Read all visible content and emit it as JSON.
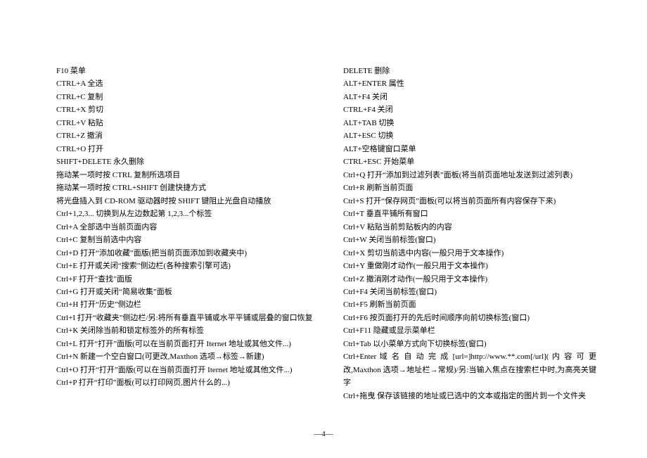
{
  "left": [
    "F10 菜单",
    "CTRL+A 全选",
    "CTRL+C 复制",
    "CTRL+X 剪切",
    "CTRL+V 粘贴",
    "CTRL+Z 撤消",
    "CTRL+O 打开",
    "SHIFT+DELETE 永久删除",
    "拖动某一项时按 CTRL 复制所选项目",
    "拖动某一项时按 CTRL+SHIFT 创建快捷方式",
    "将光盘插入到 CD-ROM 驱动器时按 SHIFT 键阻止光盘自动播放",
    "Ctrl+1,2,3...   切换到从左边数起第 1,2,3...个标签",
    "Ctrl+A   全部选中当前页面内容",
    "Ctrl+C   复制当前选中内容",
    "Ctrl+D   打开“添加收藏”面版(把当前页面添加到收藏夹中)",
    "Ctrl+E   打开或关闭“搜索”侧边栏(各种搜索引擎可选)",
    "Ctrl+F   打开“查找”面版",
    "Ctrl+G   打开或关闭“简易收集”面板",
    "Ctrl+H   打开“历史”侧边栏",
    "Ctrl+I   打开“收藏夹”侧边栏/另:将所有垂直平铺或水平平铺或层叠的窗口恢复",
    "Ctrl+K   关闭除当前和锁定标签外的所有标签",
    "Ctrl+L   打开“打开”面版(可以在当前页面打开 Iternet 地址或其他文件...)",
    "Ctrl+N   新建一个空白窗口(可更改,Maxthon 选项→标签→新建)",
    "Ctrl+O   打开“打开”面版(可以在当前页面打开 Iternet 地址或其他文件...)",
    "Ctrl+P   打开“打印”面板(可以打印网页,图片什么的...)"
  ],
  "right": [
    "DELETE 删除",
    "ALT+ENTER 属性",
    "ALT+F4 关闭",
    "CTRL+F4 关闭",
    "ALT+TAB 切换",
    "ALT+ESC 切换",
    "ALT+空格键窗口菜单",
    "CTRL+ESC 开始菜单",
    "Ctrl+Q   打开“添加到过滤列表”面板(将当前页面地址发送到过滤列表)",
    "Ctrl+R   刷新当前页面",
    "Ctrl+S   打开“保存网页”面板(可以将当前页面所有内容保存下来)",
    "Ctrl+T   垂直平铺所有窗口",
    "Ctrl+V   粘贴当前剪贴板内的内容",
    "Ctrl+W   关闭当前标签(窗口)",
    "Ctrl+X   剪切当前选中内容(一般只用于文本操作)",
    "Ctrl+Y   重做刚才动作(一般只用于文本操作)",
    "Ctrl+Z   撤消刚才动作(一般只用于文本操作)",
    "Ctrl+F4   关闭当前标签(窗口)",
    "Ctrl+F5   刷新当前页面",
    "Ctrl+F6   按页面打开的先后时间顺序向前切换标签(窗口)",
    "Ctrl+F11   隐藏或显示菜单栏",
    "Ctrl+Tab   以小菜单方式向下切换标签(窗口)",
    "Ctrl+Enter     域 名 自 动 完 成 [url=]http://www.**.com[/url]( 内 容 可 更改,Maxthon 选项→地址栏→常规)/另:当输入焦点在搜索栏中时,为高亮关键字",
    "Ctrl+拖曳   保存该链接的地址或已选中的文本或指定的图片到一个文件夹"
  ],
  "footer": "—4—"
}
